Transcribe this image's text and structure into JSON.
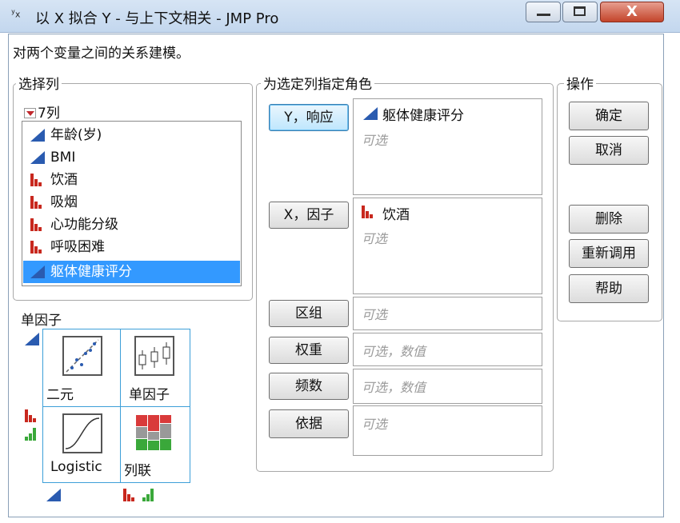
{
  "window": {
    "title": "以 X 拟合 Y - 与上下文相关 - JMP Pro",
    "title_icon": "yx-platform-icon",
    "close_glyph": "X"
  },
  "description": "对两个变量之间的关系建模。",
  "select_columns": {
    "legend": "选择列",
    "count_label": "7列",
    "items": [
      {
        "label": "年龄(岁)",
        "type": "continuous",
        "selected": false
      },
      {
        "label": "BMI",
        "type": "continuous",
        "selected": false
      },
      {
        "label": "饮酒",
        "type": "nominal",
        "selected": false
      },
      {
        "label": "吸烟",
        "type": "nominal",
        "selected": false
      },
      {
        "label": "心功能分级",
        "type": "nominal",
        "selected": false
      },
      {
        "label": "呼吸困难",
        "type": "nominal",
        "selected": false
      },
      {
        "label": "躯体健康评分",
        "type": "continuous",
        "selected": true
      }
    ]
  },
  "assign_roles": {
    "legend": "为选定列指定角色",
    "roles": [
      {
        "button": "Y，响应",
        "assigned": "躯体健康评分",
        "assigned_type": "continuous",
        "hint": "可选"
      },
      {
        "button": "X，因子",
        "assigned": "饮酒",
        "assigned_type": "nominal",
        "hint": "可选"
      },
      {
        "button": "区组",
        "assigned": "",
        "hint": "可选"
      },
      {
        "button": "权重",
        "assigned": "",
        "hint": "可选，数值"
      },
      {
        "button": "频数",
        "assigned": "",
        "hint": "可选，数值"
      },
      {
        "button": "依据",
        "assigned": "",
        "hint": "可选"
      }
    ]
  },
  "actions": {
    "legend": "操作",
    "ok": "确定",
    "cancel": "取消",
    "remove": "删除",
    "recall": "重新调用",
    "help": "帮助"
  },
  "platform_matrix": {
    "title": "单因子",
    "cells": [
      {
        "label": "二元",
        "icon": "scatterplot-icon"
      },
      {
        "label": "单因子",
        "icon": "oneway-icon"
      },
      {
        "label": "Logistic",
        "icon": "logistic-curve-icon"
      },
      {
        "label": "列联",
        "icon": "mosaic-icon"
      }
    ]
  },
  "colors": {
    "continuous": "#2a5bb0",
    "nominal": "#c8281e",
    "ordinal": "#3aa83a",
    "selection": "#3399ff",
    "default_button": "#bee6fd",
    "platform_border": "#3d9fd8"
  }
}
